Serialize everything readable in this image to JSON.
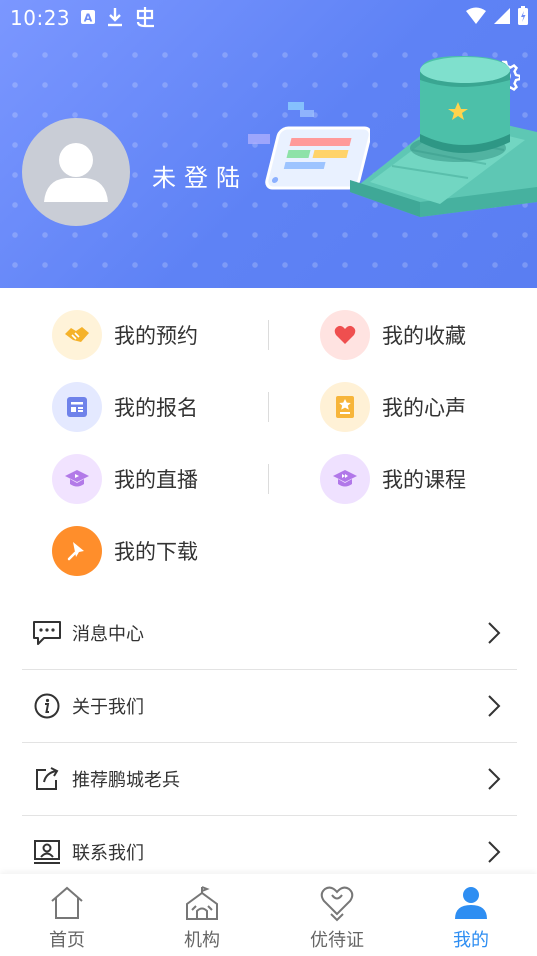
{
  "status": {
    "time": "10:23"
  },
  "header": {
    "login_text": "未登陆"
  },
  "menu": [
    {
      "label": "我的预约",
      "icon": "handshake-icon",
      "bg": "#fff3d9",
      "fg": "#f5b22a"
    },
    {
      "label": "我的收藏",
      "icon": "heart-icon",
      "bg": "#ffe3e1",
      "fg": "#ef4f4f"
    },
    {
      "label": "我的报名",
      "icon": "form-icon",
      "bg": "#e4e9ff",
      "fg": "#6f82ea"
    },
    {
      "label": "我的心声",
      "icon": "note-star-icon",
      "bg": "#fff1d6",
      "fg": "#f7b53a"
    },
    {
      "label": "我的直播",
      "icon": "graduation-cap-icon",
      "bg": "#f1e3ff",
      "fg": "#b27ae8"
    },
    {
      "label": "我的课程",
      "icon": "play-cap-icon",
      "bg": "#efe1ff",
      "fg": "#b177e9"
    },
    {
      "label": "我的下载",
      "icon": "download-pin-icon",
      "bg": "#ff8e2b",
      "fg": "#ffffff"
    }
  ],
  "list": [
    {
      "label": "消息中心",
      "icon": "chat-icon"
    },
    {
      "label": "关于我们",
      "icon": "info-icon"
    },
    {
      "label": "推荐鹏城老兵",
      "icon": "share-icon"
    },
    {
      "label": "联系我们",
      "icon": "contact-card-icon"
    }
  ],
  "tabs": [
    {
      "label": "首页",
      "icon": "home-icon",
      "active": false
    },
    {
      "label": "机构",
      "icon": "building-icon",
      "active": false
    },
    {
      "label": "优待证",
      "icon": "heart-badge-icon",
      "active": false
    },
    {
      "label": "我的",
      "icon": "person-icon",
      "active": true
    }
  ],
  "colors": {
    "accent": "#2e8ef2",
    "banner_start": "#7b97ff",
    "banner_end": "#5a7ef2"
  }
}
